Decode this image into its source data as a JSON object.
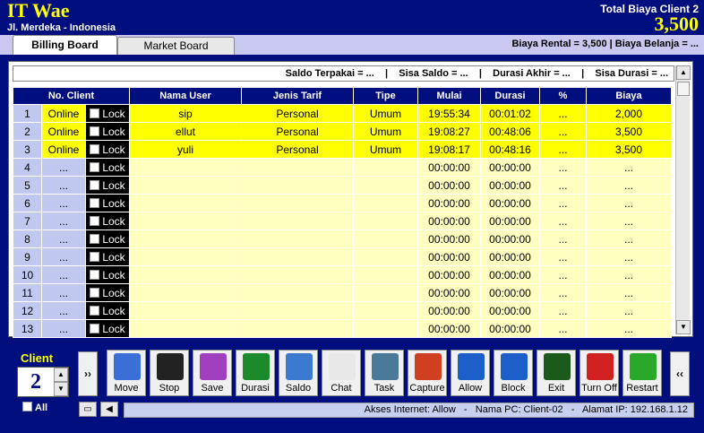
{
  "header": {
    "title": "IT Wae",
    "subtitle": "Jl. Merdeka - Indonesia",
    "total_label": "Total Biaya Client 2",
    "total_value": "3,500"
  },
  "tabs": [
    {
      "label": "Billing Board",
      "active": true
    },
    {
      "label": "Market Board",
      "active": false
    }
  ],
  "tab_info": "Biaya Rental = 3,500    |    Biaya Belanja = ...",
  "info_bar": "Saldo Terpakai = ...    |    Sisa Saldo = ...    |    Durasi Akhir = ...    |    Sisa Durasi = ...",
  "table": {
    "headers": {
      "client": "No. Client",
      "user": "Nama User",
      "tarif": "Jenis Tarif",
      "tipe": "Tipe",
      "mulai": "Mulai",
      "durasi": "Durasi",
      "persen": "%",
      "biaya": "Biaya"
    },
    "lock_label": "Lock",
    "rows": [
      {
        "no": "1",
        "status": "Online",
        "user": "sip",
        "tarif": "Personal",
        "tipe": "Umum",
        "mulai": "19:55:34",
        "durasi": "00:01:02",
        "persen": "...",
        "biaya": "2,000",
        "active": true
      },
      {
        "no": "2",
        "status": "Online",
        "user": "ellut",
        "tarif": "Personal",
        "tipe": "Umum",
        "mulai": "19:08:27",
        "durasi": "00:48:06",
        "persen": "...",
        "biaya": "3,500",
        "active": true
      },
      {
        "no": "3",
        "status": "Online",
        "user": "yuli",
        "tarif": "Personal",
        "tipe": "Umum",
        "mulai": "19:08:17",
        "durasi": "00:48:16",
        "persen": "...",
        "biaya": "3,500",
        "active": true
      },
      {
        "no": "4",
        "status": "...",
        "user": "",
        "tarif": "",
        "tipe": "",
        "mulai": "00:00:00",
        "durasi": "00:00:00",
        "persen": "...",
        "biaya": "...",
        "active": false
      },
      {
        "no": "5",
        "status": "...",
        "user": "",
        "tarif": "",
        "tipe": "",
        "mulai": "00:00:00",
        "durasi": "00:00:00",
        "persen": "...",
        "biaya": "...",
        "active": false
      },
      {
        "no": "6",
        "status": "...",
        "user": "",
        "tarif": "",
        "tipe": "",
        "mulai": "00:00:00",
        "durasi": "00:00:00",
        "persen": "...",
        "biaya": "...",
        "active": false
      },
      {
        "no": "7",
        "status": "...",
        "user": "",
        "tarif": "",
        "tipe": "",
        "mulai": "00:00:00",
        "durasi": "00:00:00",
        "persen": "...",
        "biaya": "...",
        "active": false
      },
      {
        "no": "8",
        "status": "...",
        "user": "",
        "tarif": "",
        "tipe": "",
        "mulai": "00:00:00",
        "durasi": "00:00:00",
        "persen": "...",
        "biaya": "...",
        "active": false
      },
      {
        "no": "9",
        "status": "...",
        "user": "",
        "tarif": "",
        "tipe": "",
        "mulai": "00:00:00",
        "durasi": "00:00:00",
        "persen": "...",
        "biaya": "...",
        "active": false
      },
      {
        "no": "10",
        "status": "...",
        "user": "",
        "tarif": "",
        "tipe": "",
        "mulai": "00:00:00",
        "durasi": "00:00:00",
        "persen": "...",
        "biaya": "...",
        "active": false
      },
      {
        "no": "11",
        "status": "...",
        "user": "",
        "tarif": "",
        "tipe": "",
        "mulai": "00:00:00",
        "durasi": "00:00:00",
        "persen": "...",
        "biaya": "...",
        "active": false
      },
      {
        "no": "12",
        "status": "...",
        "user": "",
        "tarif": "",
        "tipe": "",
        "mulai": "00:00:00",
        "durasi": "00:00:00",
        "persen": "...",
        "biaya": "...",
        "active": false
      },
      {
        "no": "13",
        "status": "...",
        "user": "",
        "tarif": "",
        "tipe": "",
        "mulai": "00:00:00",
        "durasi": "00:00:00",
        "persen": "...",
        "biaya": "...",
        "active": false
      }
    ]
  },
  "client": {
    "label": "Client",
    "value": "2",
    "all_label": "All"
  },
  "nav": {
    "next": "››",
    "prev": "‹‹"
  },
  "buttons": [
    {
      "label": "Move",
      "icon": "move-icon",
      "color": "#3b6fd8"
    },
    {
      "label": "Stop",
      "icon": "stop-icon",
      "color": "#222222"
    },
    {
      "label": "Save",
      "icon": "save-icon",
      "color": "#a040c0"
    },
    {
      "label": "Durasi",
      "icon": "durasi-icon",
      "color": "#1a8a2a"
    },
    {
      "label": "Saldo",
      "icon": "saldo-icon",
      "color": "#3c7ad0"
    },
    {
      "label": "Chat",
      "icon": "chat-icon",
      "color": "#e8e8e8"
    },
    {
      "label": "Task",
      "icon": "task-icon",
      "color": "#4a7a9a"
    },
    {
      "label": "Capture",
      "icon": "capture-icon",
      "color": "#d04020"
    },
    {
      "label": "Allow",
      "icon": "allow-icon",
      "color": "#1c5fc8"
    },
    {
      "label": "Block",
      "icon": "block-icon",
      "color": "#1c5fc8"
    },
    {
      "label": "Exit",
      "icon": "exit-icon",
      "color": "#1a5a1a"
    },
    {
      "label": "Turn Off",
      "icon": "power-icon",
      "color": "#d02020"
    },
    {
      "label": "Restart",
      "icon": "restart-icon",
      "color": "#2aa82a"
    }
  ],
  "status_bar": "Akses Internet: Allow   -   Nama PC: Client-02   -   Alamat IP: 192.168.1.12",
  "colors": {
    "background": "#010e7e",
    "highlight": "#ffff00",
    "idle_row": "#ffffc0",
    "index_cell": "#c0c8f0"
  }
}
